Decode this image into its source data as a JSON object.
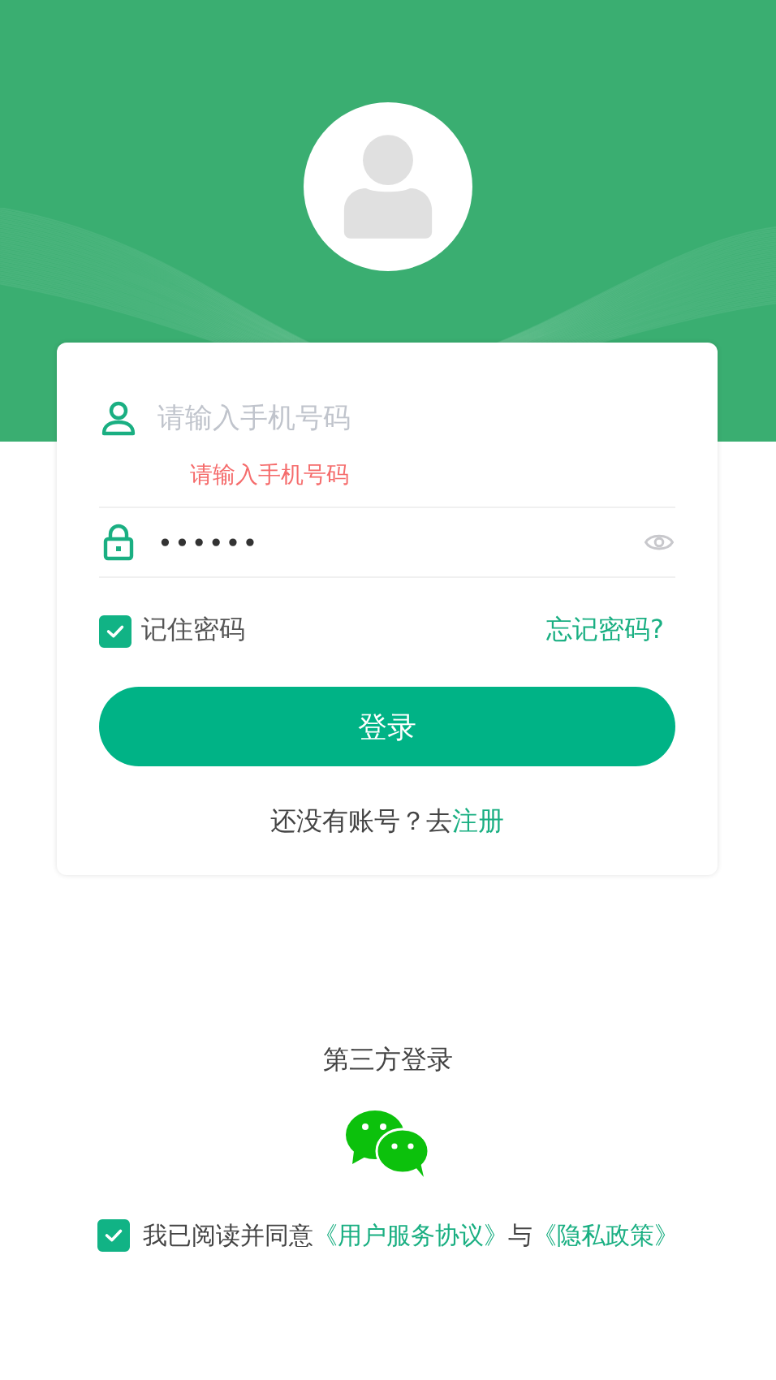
{
  "login_form": {
    "phone_field": {
      "placeholder": "请输入手机号码",
      "error": "请输入手机号码"
    },
    "password_field": {
      "value": "••••••"
    },
    "remember": {
      "label": "记住密码",
      "checked": true
    },
    "forgot_link": "忘记密码?",
    "login_button": "登录",
    "register_prompt": {
      "text": "还没有账号？去",
      "link": "注册"
    }
  },
  "third_party": {
    "title": "第三方登录"
  },
  "agreement": {
    "checked": true,
    "parts": [
      {
        "kind": "text",
        "text": "我已阅读并同意"
      },
      {
        "kind": "link",
        "text": "《用户服务协议》"
      },
      {
        "kind": "text",
        "text": "与"
      },
      {
        "kind": "link",
        "text": "《隐私政策》"
      }
    ]
  }
}
